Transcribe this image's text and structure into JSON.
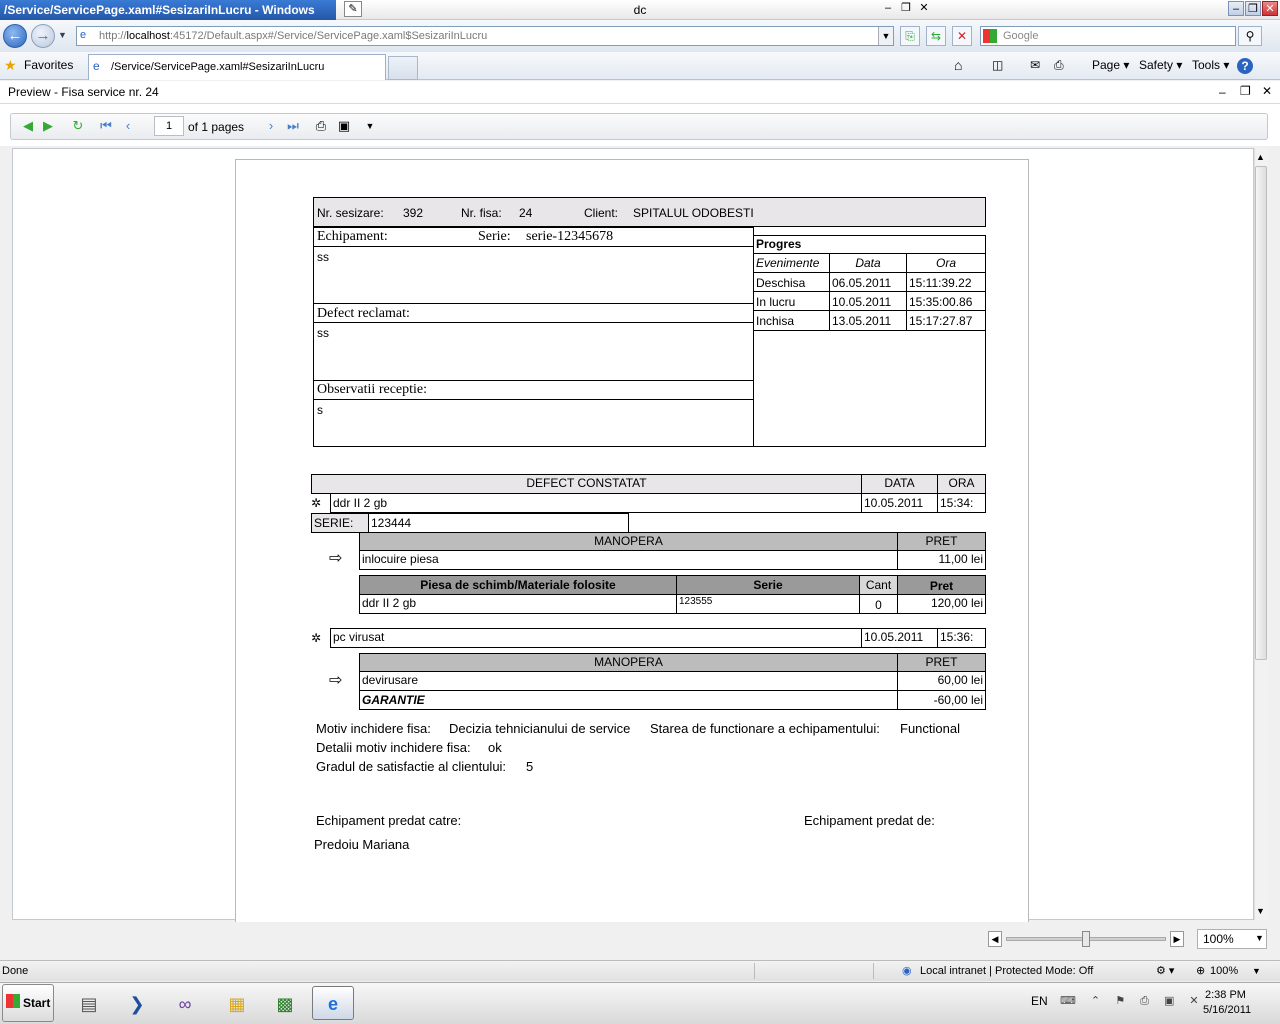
{
  "window": {
    "title": "/Service/ServicePage.xaml#SesizariInLucru - Windows",
    "center_title": "dc"
  },
  "nav": {
    "address_prefix": "http://",
    "address_host": "localhost",
    "address_rest": ":45172/Default.aspx#/Service/ServicePage.xaml$SesizariInLucru",
    "search_placeholder": "Google"
  },
  "favorites": {
    "favorites_label": "Favorites",
    "tab_title": "/Service/ServicePage.xaml#SesizariInLucru",
    "page_label": "Page",
    "safety_label": "Safety",
    "tools_label": "Tools"
  },
  "preview": {
    "title": "Preview - Fisa service nr. 24",
    "page_number": "1",
    "page_of": "of 1 pages"
  },
  "report": {
    "nr_sesizare_label": "Nr. sesizare:",
    "nr_sesizare": "392",
    "nr_fisa_label": "Nr. fisa:",
    "nr_fisa": "24",
    "client_label": "Client:",
    "client": "SPITALUL ODOBESTI",
    "echipament_label": "Echipament:",
    "serie_label": "Serie:",
    "serie": "serie-12345678",
    "echipament_value": "ss",
    "defect_reclamat_label": "Defect reclamat:",
    "defect_reclamat_value": "ss",
    "observatii_label": "Observatii receptie:",
    "observatii_value": "s",
    "progres": {
      "title": "Progres",
      "headers": [
        "Evenimente",
        "Data",
        "Ora"
      ],
      "rows": [
        {
          "event": "Deschisa",
          "date": "06.05.2011",
          "time": "15:11:39.22"
        },
        {
          "event": "In lucru",
          "date": "10.05.2011",
          "time": "15:35:00.86"
        },
        {
          "event": "Inchisa",
          "date": "13.05.2011",
          "time": "15:17:27.87"
        }
      ]
    },
    "defect_header": "DEFECT CONSTATAT",
    "data_header": "DATA",
    "ora_header": "ORA",
    "defect1": {
      "name": "ddr II 2 gb",
      "date": "10.05.2011",
      "time": "15:34:",
      "serie_label": "SERIE:",
      "serie": "123444",
      "manopera_header": "MANOPERA",
      "pret_header": "PRET",
      "manopera": "inlocuire piesa",
      "manopera_pret": "11,00 lei",
      "piese_header": "Piesa de schimb/Materiale folosite",
      "piese_serie_header": "Serie",
      "piese_cant_header": "Cant",
      "piese_pret_header": "Pret",
      "piesa": "ddr II 2 gb",
      "piesa_serie": "123555",
      "piesa_cant": "0",
      "piesa_pret": "120,00 lei"
    },
    "defect2": {
      "name": "pc virusat",
      "date": "10.05.2011",
      "time": "15:36:",
      "manopera_header": "MANOPERA",
      "pret_header": "PRET",
      "manopera": "devirusare",
      "manopera_pret": "60,00 lei",
      "garantie": "GARANTIE",
      "garantie_pret": "-60,00 lei"
    },
    "motiv_label": "Motiv inchidere fisa:",
    "motiv": "Decizia tehnicianului de service",
    "stare_label": "Starea de functionare a echipamentului:",
    "stare": "Functional",
    "detalii_label": "Detalii motiv inchidere fisa:",
    "detalii": "ok",
    "satisfactie_label": "Gradul de satisfactie al clientului:",
    "satisfactie": "5",
    "predat_catre_label": "Echipament predat catre:",
    "predat_de_label": "Echipament predat de:",
    "predat_catre": "Predoiu Mariana"
  },
  "zoom": {
    "level": "100%"
  },
  "status": {
    "left": "Done",
    "zone": "Local intranet | Protected Mode: Off",
    "zoom": "100%"
  },
  "taskbar": {
    "start": "Start",
    "lang": "EN",
    "time": "2:38 PM",
    "date": "5/16/2011"
  }
}
